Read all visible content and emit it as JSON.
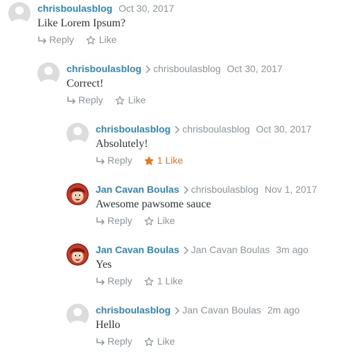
{
  "comments": [
    {
      "id": "c1",
      "author": "chrisboulasblog",
      "parent": "",
      "date": "Oct 30, 2017",
      "text": "Like Lorem Ipsum?",
      "avatar": "gray",
      "reply_label": "Reply",
      "like_label": "Like",
      "liked": false
    },
    {
      "id": "c2",
      "author": "chrisboulasblog",
      "parent": "chrisboulasblog",
      "date": "Oct 30, 2017",
      "text": "Correct!",
      "avatar": "gray",
      "reply_label": "Reply",
      "like_label": "Like",
      "liked": false
    },
    {
      "id": "c3",
      "author": "chrisboulasblog",
      "parent": "chrisboulasblog",
      "date": "Oct 30, 2017",
      "text": "Absolutely!",
      "avatar": "gray",
      "reply_label": "Reply",
      "like_label": "1 Like",
      "liked": true
    },
    {
      "id": "c4",
      "author": "Jan Cavan Boulas",
      "parent": "chrisboulasblog",
      "date": "Nov 1, 2017",
      "text": "Awesome pawsome sauce",
      "avatar": "cartoon",
      "reply_label": "Reply",
      "like_label": "Like",
      "liked": false
    },
    {
      "id": "c5",
      "author": "Jan Cavan Boulas",
      "parent": "Jan Cavan Boulas",
      "date": "3m ago",
      "text": "Yes",
      "avatar": "cartoon",
      "reply_label": "Reply",
      "like_label": "1 Like",
      "liked": false
    },
    {
      "id": "c6",
      "author": "chrisboulasblog",
      "parent": "Jan Cavan Boulas",
      "date": "2m ago",
      "text": "Hello",
      "avatar": "gray",
      "reply_label": "Reply",
      "like_label": "Like",
      "liked": false
    }
  ],
  "colors": {
    "author": "#2f87b7",
    "muted": "#8c959c",
    "liked": "#e8761f",
    "text": "#2c3338"
  },
  "icons": {
    "reply": "reply-arrow-icon",
    "like": "star-outline-icon",
    "liked": "star-filled-icon",
    "chevron": "chevron-right-icon"
  }
}
